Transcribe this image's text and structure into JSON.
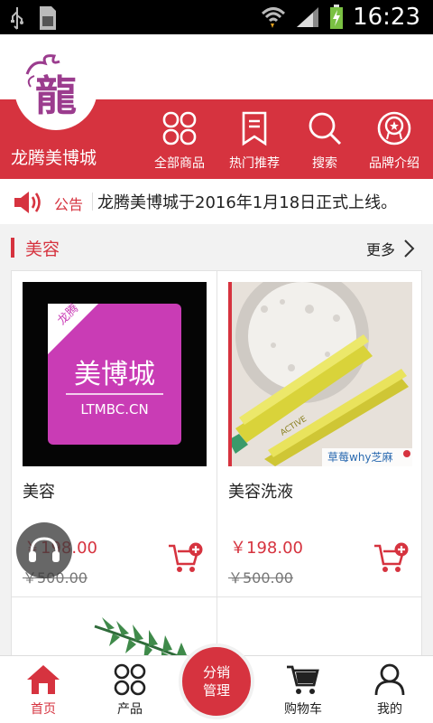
{
  "status_bar": {
    "time": "16:23"
  },
  "header": {
    "logo_char": "龍",
    "brand_name": "龙腾美博城",
    "nav": [
      {
        "label": "全部商品",
        "icon": "grid-icon"
      },
      {
        "label": "热门推荐",
        "icon": "bookmark-icon"
      },
      {
        "label": "搜索",
        "icon": "search-icon"
      },
      {
        "label": "品牌介绍",
        "icon": "medal-icon"
      }
    ]
  },
  "notice": {
    "tag": "公告",
    "text": "龙腾美博城于2016年1月18日正式上线。"
  },
  "section": {
    "title": "美容",
    "more": "更多"
  },
  "products": [
    {
      "name": "美容",
      "price": "￥198.00",
      "original_price": "￥500.00",
      "image": {
        "corner": "龙腾",
        "title": "美博城",
        "domain": "LTMBC.CN"
      }
    },
    {
      "name": "美容洗液",
      "price": "￥198.00",
      "original_price": "￥500.00",
      "image": {
        "watermark": "草莓why芝麻"
      }
    }
  ],
  "tabbar": {
    "tabs": [
      {
        "label": "首页",
        "icon": "home-icon",
        "active": true
      },
      {
        "label": "产品",
        "icon": "grid-icon"
      },
      {
        "label": "购物车",
        "icon": "cart-icon"
      },
      {
        "label": "我的",
        "icon": "person-icon"
      }
    ],
    "center": {
      "line1": "分销",
      "line2": "管理"
    }
  },
  "colors": {
    "brand": "#d6333f",
    "product_pink": "#c93cb5"
  }
}
